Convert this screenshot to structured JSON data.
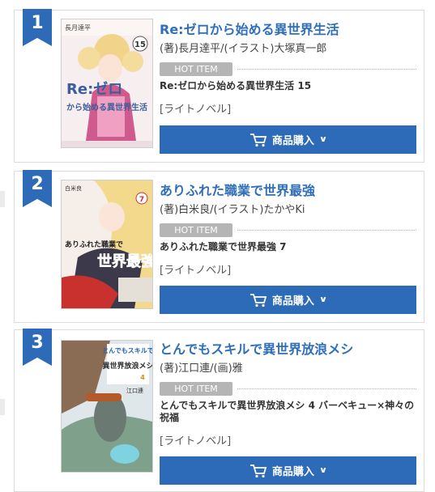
{
  "colors": {
    "accent": "#2d6ab7",
    "title": "#2f6fba",
    "badge": "#b5b5b5"
  },
  "rankings": [
    {
      "rank": "1",
      "title": "Re:ゼロから始める異世界生活",
      "authors": "(著)長月達平/(イラスト)大塚真一郎",
      "hot_label": "HOT ITEM",
      "item_name": "Re:ゼロから始める異世界生活 15",
      "genre": "[ライトノベル]",
      "buy_label": "商品購入",
      "cover": {
        "author": "長月達平",
        "volume": "15",
        "line1": "Re:ゼロ",
        "line2": "から始める異世界生活"
      }
    },
    {
      "rank": "2",
      "title": "ありふれた職業で世界最強",
      "authors": "(著)白米良/(イラスト)たかやKi",
      "hot_label": "HOT ITEM",
      "item_name": "ありふれた職業で世界最強 7",
      "genre": "[ライトノベル]",
      "buy_label": "商品購入",
      "cover": {
        "author": "白米良",
        "volume": "7",
        "line1": "ありふれた職業で",
        "line2": "世界最強"
      }
    },
    {
      "rank": "3",
      "title": "とんでもスキルで異世界放浪メシ",
      "authors": "(著)江口連/(画)雅",
      "hot_label": "HOT ITEM",
      "item_name": "とんでもスキルで異世界放浪メシ 4 バーベキュー×神々の祝福",
      "genre": "[ライトノベル]",
      "buy_label": "商品購入",
      "cover": {
        "author": "江口連",
        "volume": "4",
        "line1": "とんでもスキルで",
        "line2": "異世界放浪メシ"
      }
    }
  ]
}
